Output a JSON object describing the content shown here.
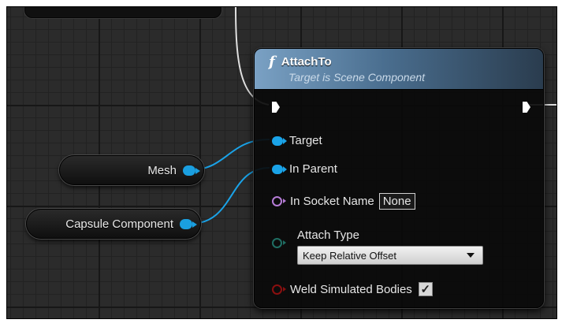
{
  "func_node": {
    "glyph": "f",
    "title": "AttachTo",
    "subtitle": "Target is Scene Component",
    "pins": {
      "target": "Target",
      "in_parent": "In Parent",
      "in_socket_name": "In Socket Name",
      "in_socket_value": "None",
      "attach_type": "Attach Type",
      "attach_type_value": "Keep Relative Offset",
      "weld": "Weld Simulated Bodies",
      "weld_checked": "✓"
    }
  },
  "variables": {
    "mesh": "Mesh",
    "capsule": "Capsule Component"
  },
  "colors": {
    "object_pin": "#1aa3e8",
    "name_pin": "#b57cd6",
    "enum_pin": "#1f6e63",
    "bool_pin": "#8a0f0f",
    "exec_wire": "#e0e0e0",
    "header_accent": "#7aa1c4"
  },
  "icons": {
    "function": "function-icon",
    "exec_in": "exec-pin-icon",
    "exec_out": "exec-pin-icon",
    "dropdown": "chevron-down-icon",
    "check": "checkmark-icon"
  }
}
